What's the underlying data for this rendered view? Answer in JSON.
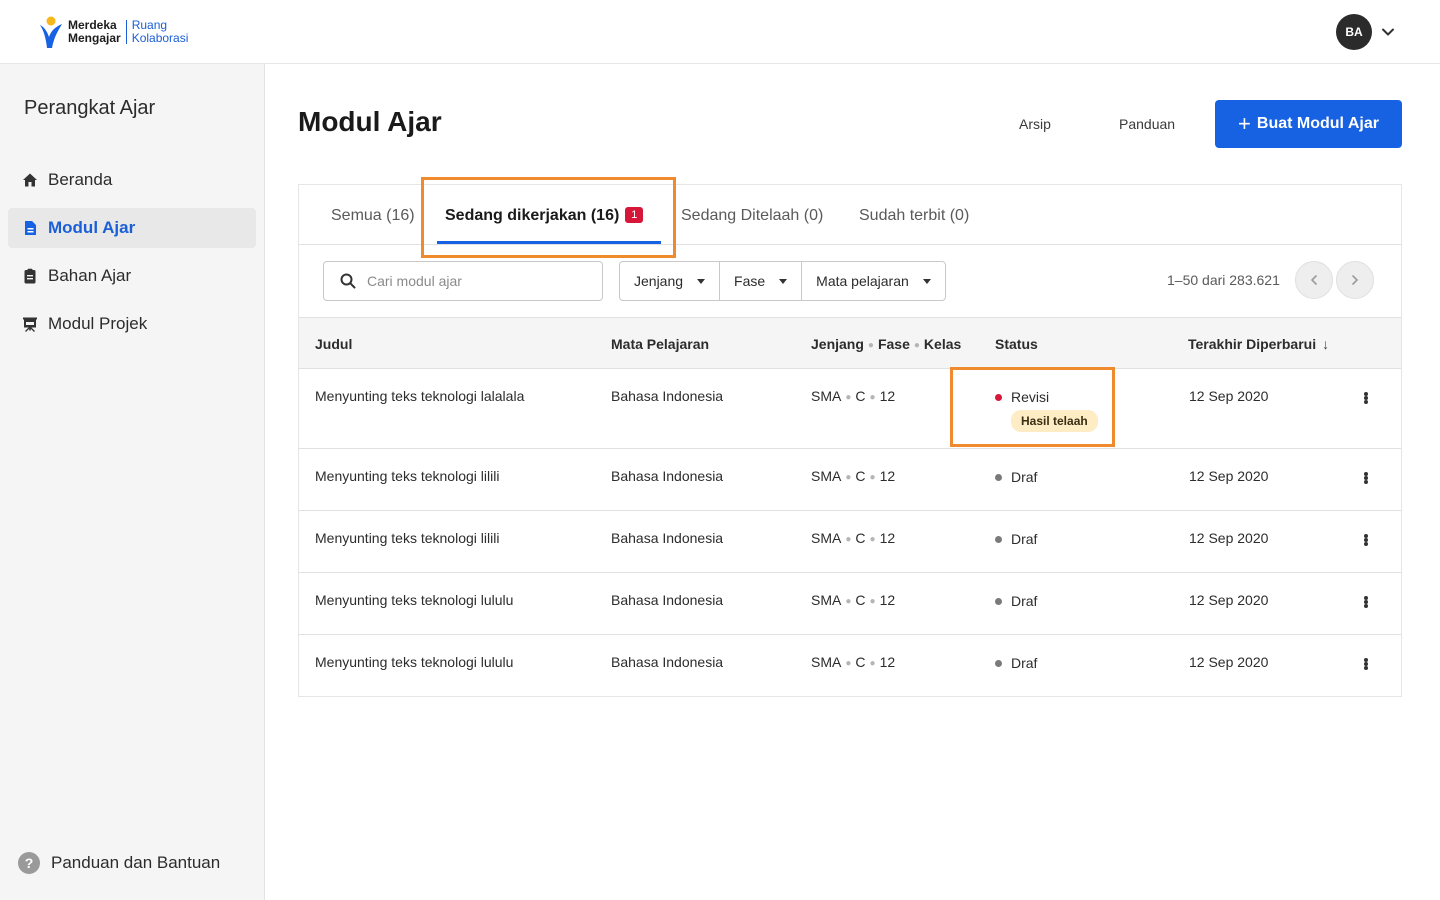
{
  "header": {
    "logo_brand_line1": "Merdeka",
    "logo_brand_line2": "Mengajar",
    "logo_sub_line1": "Ruang",
    "logo_sub_line2": "Kolaborasi",
    "avatar_initials": "BA",
    "avatar_menu_icon": "chevron-down-icon"
  },
  "sidebar": {
    "title": "Perangkat Ajar",
    "items": [
      {
        "label": "Beranda",
        "icon": "home-icon",
        "active": false
      },
      {
        "label": "Modul Ajar",
        "icon": "document-icon",
        "active": true
      },
      {
        "label": "Bahan Ajar",
        "icon": "clipboard-icon",
        "active": false
      },
      {
        "label": "Modul Projek",
        "icon": "presentation-icon",
        "active": false
      }
    ],
    "help_label": "Panduan dan Bantuan",
    "help_icon": "help-icon"
  },
  "main": {
    "title": "Modul Ajar",
    "archive_label": "Arsip",
    "guide_label": "Panduan",
    "create_label": "Buat Modul Ajar",
    "tabs": [
      {
        "label": "Semua (16)"
      },
      {
        "label": "Sedang dikerjakan (16)",
        "badge": "1",
        "active": true
      },
      {
        "label": "Sedang Ditelaah (0)"
      },
      {
        "label": "Sudah terbit (0)"
      }
    ],
    "search": {
      "placeholder": "Cari modul ajar"
    },
    "filters": [
      "Jenjang",
      "Fase",
      "Mata pelajaran"
    ],
    "pagination": {
      "text": "1–50 dari 283.621"
    },
    "table": {
      "headers": {
        "title": "Judul",
        "subject": "Mata Pelajaran",
        "level": "Jenjang",
        "phase": "Fase",
        "grade": "Kelas",
        "status": "Status",
        "updated": "Terakhir Diperbarui"
      },
      "rows": [
        {
          "title": "Menyunting teks teknologi lalalala",
          "subject": "Bahasa Indonesia",
          "level": "SMA",
          "phase": "C",
          "grade": "12",
          "status": "Revisi",
          "status_tag": "Hasil telaah",
          "updated": "12 Sep 2020"
        },
        {
          "title": "Menyunting teks teknologi lilili",
          "subject": "Bahasa Indonesia",
          "level": "SMA",
          "phase": "C",
          "grade": "12",
          "status": "Draf",
          "updated": "12 Sep 2020"
        },
        {
          "title": "Menyunting teks teknologi lilili",
          "subject": "Bahasa Indonesia",
          "level": "SMA",
          "phase": "C",
          "grade": "12",
          "status": "Draf",
          "updated": "12 Sep 2020"
        },
        {
          "title": "Menyunting teks teknologi lululu",
          "subject": "Bahasa Indonesia",
          "level": "SMA",
          "phase": "C",
          "grade": "12",
          "status": "Draf",
          "updated": "12 Sep 2020"
        },
        {
          "title": "Menyunting teks teknologi lululu",
          "subject": "Bahasa Indonesia",
          "level": "SMA",
          "phase": "C",
          "grade": "12",
          "status": "Draf",
          "updated": "12 Sep 2020"
        }
      ]
    }
  },
  "colors": {
    "primary": "#1761e3",
    "status_revisi": "#d6173a",
    "status_draf": "#7a7a7a",
    "highlight": "#f08a2e",
    "tag_bg": "#fdecc4"
  }
}
